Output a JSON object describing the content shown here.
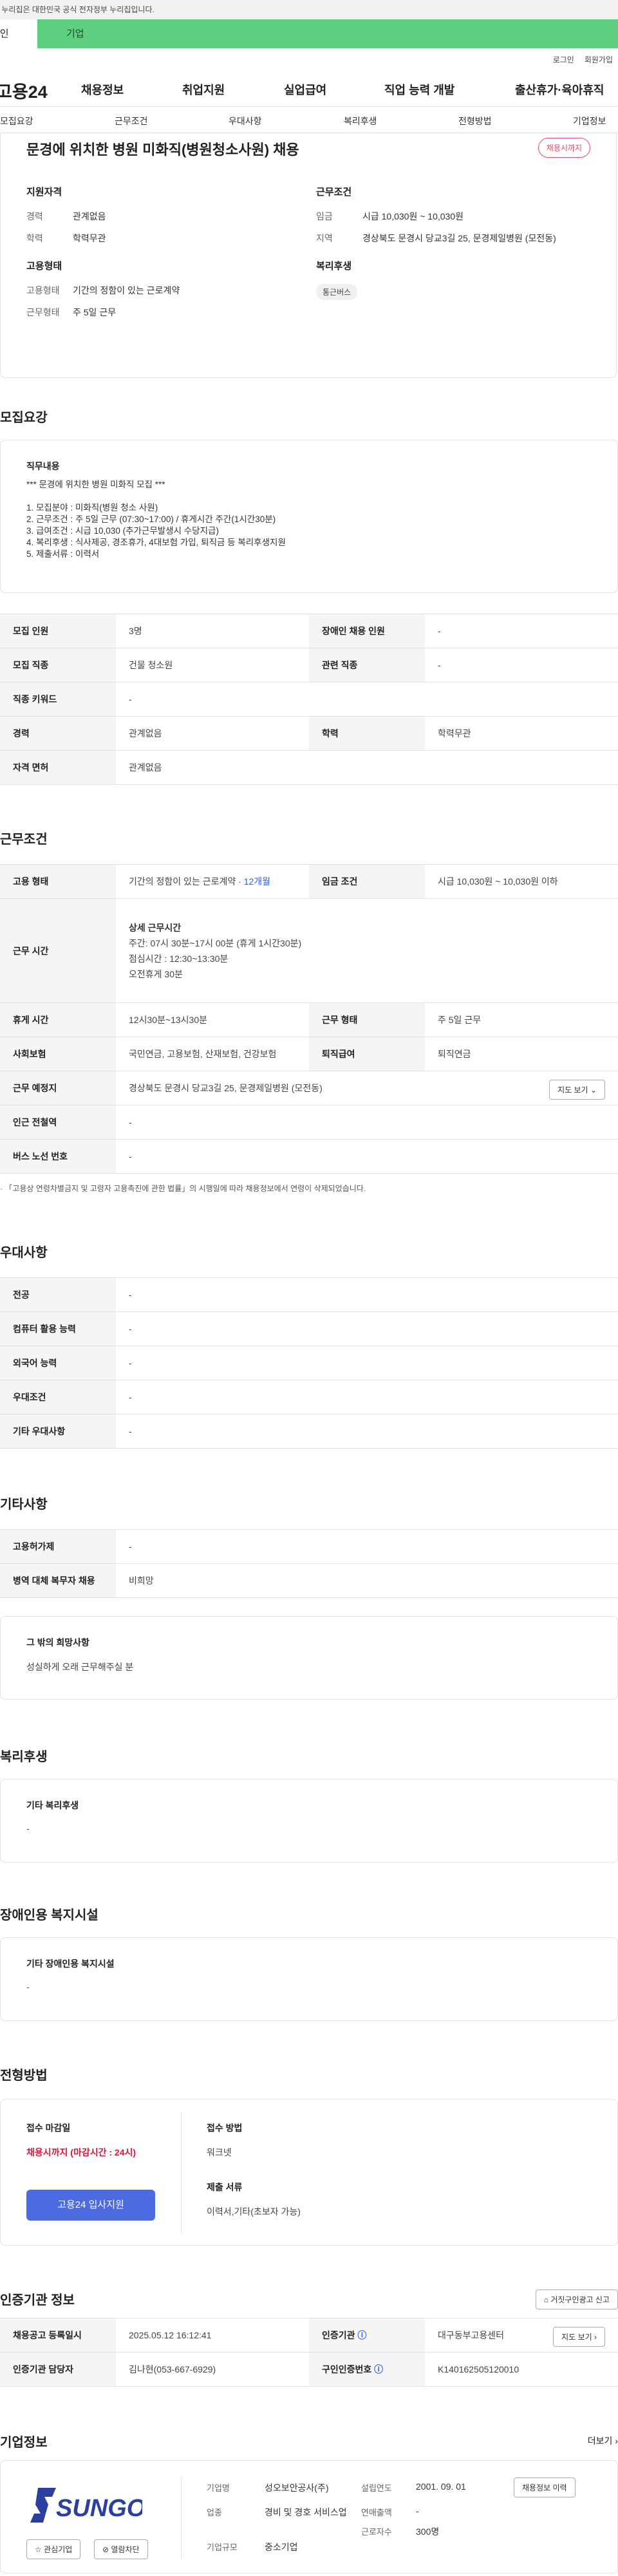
{
  "gov_notice": "이 누리집은 대한민국 공식 전자정부 누리집입니다.",
  "tabs": {
    "person": "개인",
    "company": "기업"
  },
  "util": {
    "login": "로그인",
    "signup": "회원가입"
  },
  "gnb": {
    "logo": "고용24",
    "items": [
      "채용정보",
      "취업지원",
      "실업급여",
      "직업 능력 개발",
      "출산휴가·육아휴직"
    ]
  },
  "subnav": [
    "모집요강",
    "근무조건",
    "우대사항",
    "복리후생",
    "전형방법",
    "기업정보"
  ],
  "summary": {
    "title": "문경에 위치한 병원 미화직(병원청소사원) 채용",
    "badge": "채용시까지",
    "qual_h": "지원자격",
    "career_k": "경력",
    "career_v": "관계없음",
    "edu_k": "학력",
    "edu_v": "학력무관",
    "emp_h": "고용형태",
    "emp_k": "고용형태",
    "emp_v": "기간의 정함이 있는 근로계약",
    "days_k": "근무형태",
    "days_v": "주 5일 근무",
    "cond_h": "근무조건",
    "wage_k": "임금",
    "wage_v": "시급 10,030원 ~ 10,030원",
    "loc_k": "지역",
    "loc_v": "경상북도 문경시 당교3길 25, 문경제일병원 (모전동)",
    "welfare_h": "복리후생",
    "welfare_chip": "통근버스"
  },
  "recruit": {
    "heading": "모집요강",
    "duty_h": "직무내용",
    "duty_lines": [
      "*** 문경에 위치한 병원 미화직 모집 ***",
      "",
      "1. 모집분야 : 미화직(병원 청소 사원)",
      "2. 근무조건 : 주 5일 근무 (07:30~17:00) / 휴게시간 주간(1시간30분)",
      "3. 급여조건 : 시급 10,030 (추가근무발생시 수당지급)",
      "4. 복리후생 : 식사제공, 경조휴가, 4대보험 가입, 퇴직금 등 복리후생지원",
      "5. 제출서류 : 이력서"
    ],
    "rows": [
      {
        "k1": "모집 인원",
        "v1": "3명",
        "k2": "장애인 채용 인원",
        "v2": "-"
      },
      {
        "k1": "모집 직종",
        "v1": "건물 청소원",
        "k2": "관련 직종",
        "v2": "-"
      },
      {
        "k1": "직종 키워드",
        "v1": "-"
      },
      {
        "k1": "경력",
        "v1": "관계없음",
        "k2": "학력",
        "v2": "학력무관"
      },
      {
        "k1": "자격 면허",
        "v1": "관계없음"
      }
    ]
  },
  "conditions": {
    "heading": "근무조건",
    "emp_k": "고용 형태",
    "emp_v": "기간의 정함이 있는 근로계약",
    "emp_dot": "·",
    "emp_period": "12개월",
    "wage_k": "임금 조건",
    "wage_v": "시급 10,030원 ~ 10,030원 이하",
    "time_k": "근무 시간",
    "time_h": "상세 근무시간",
    "time_lines": [
      "주간: 07시 30분~17시 00분 (휴게 1시간30분)",
      "점심시간 : 12:30~13:30분",
      "오전휴게 30분"
    ],
    "rest_k": "휴게 시간",
    "rest_v": "12시30분~13시30분",
    "form_k": "근무 형태",
    "form_v": "주 5일 근무",
    "ins_k": "사회보험",
    "ins_v": "국민연금, 고용보험, 산재보험, 건강보험",
    "ret_k": "퇴직급여",
    "ret_v": "퇴직연금",
    "place_k": "근무 예정지",
    "place_v": "경상북도 문경시 당교3길 25, 문경제일병원 (모전동)",
    "map_btn": "지도 보기",
    "subway_k": "인근 전철역",
    "subway_v": "-",
    "bus_k": "버스 노선 번호",
    "bus_v": "-",
    "footnote": "「고용상 연령차별금지 및 고령자 고용촉진에 관한 법률」의 시행일에 따라 채용정보에서 연령이 삭제되었습니다."
  },
  "preferred": {
    "heading": "우대사항",
    "rows": [
      {
        "k": "전공",
        "v": "-"
      },
      {
        "k": "컴퓨터 활용 능력",
        "v": "-"
      },
      {
        "k": "외국어 능력",
        "v": "-"
      },
      {
        "k": "우대조건",
        "v": "-"
      },
      {
        "k": "기타 우대사항",
        "v": "-"
      }
    ]
  },
  "etc": {
    "heading": "기타사항",
    "rows": [
      {
        "k": "고용허가제",
        "v": "-"
      },
      {
        "k": "병역 대체 복무자 채용",
        "v": "비희망"
      }
    ],
    "other_h": "그 밖의 희망사항",
    "other_v": "성실하게 오래 근무해주실 분"
  },
  "welfare": {
    "heading": "복리후생",
    "box_h": "기타 복리후생",
    "box_v": "-"
  },
  "disability": {
    "heading": "장애인용 복지시설",
    "box_h": "기타 장애인용 복지시설",
    "box_v": "-"
  },
  "selection": {
    "heading": "전형방법",
    "deadline_h": "접수 마감일",
    "deadline_v": "채용시까지 (마감시간 : 24시)",
    "apply_btn": "고용24 입사지원",
    "method_h": "접수 방법",
    "method_v": "워크넷",
    "docs_h": "제출 서류",
    "docs_v": "이력서,기타(초보자 가능)"
  },
  "cert": {
    "heading": "인증기관 정보",
    "report_btn": "거짓구인광고 신고",
    "reg_k": "채용공고 등록일시",
    "reg_v": "2025.05.12 16:12:41",
    "org_k": "인증기관",
    "org_v": "대구동부고용센터",
    "manager_k": "인증기관 담당자",
    "manager_v": "김나현(053-667-6929)",
    "cert_k": "구인인증번호",
    "cert_v": "K140162505120010",
    "map_btn": "지도 보기"
  },
  "company": {
    "heading": "기업정보",
    "more": "더보기",
    "logo_text": "SUNGO",
    "fav_btn": "관심기업",
    "block_btn": "열람차단",
    "name_k": "기업명",
    "name_v": "성오보안공사(주)",
    "found_k": "설립연도",
    "found_v": "2001. 09. 01",
    "biz_k": "업종",
    "biz_v": "경비 및 경호 서비스업",
    "sales_k": "연매출액",
    "sales_v": "-",
    "size_k": "기업규모",
    "size_v": "중소기업",
    "emp_k": "근로자수",
    "emp_v": "300명",
    "history_btn": "채용정보 이력"
  }
}
